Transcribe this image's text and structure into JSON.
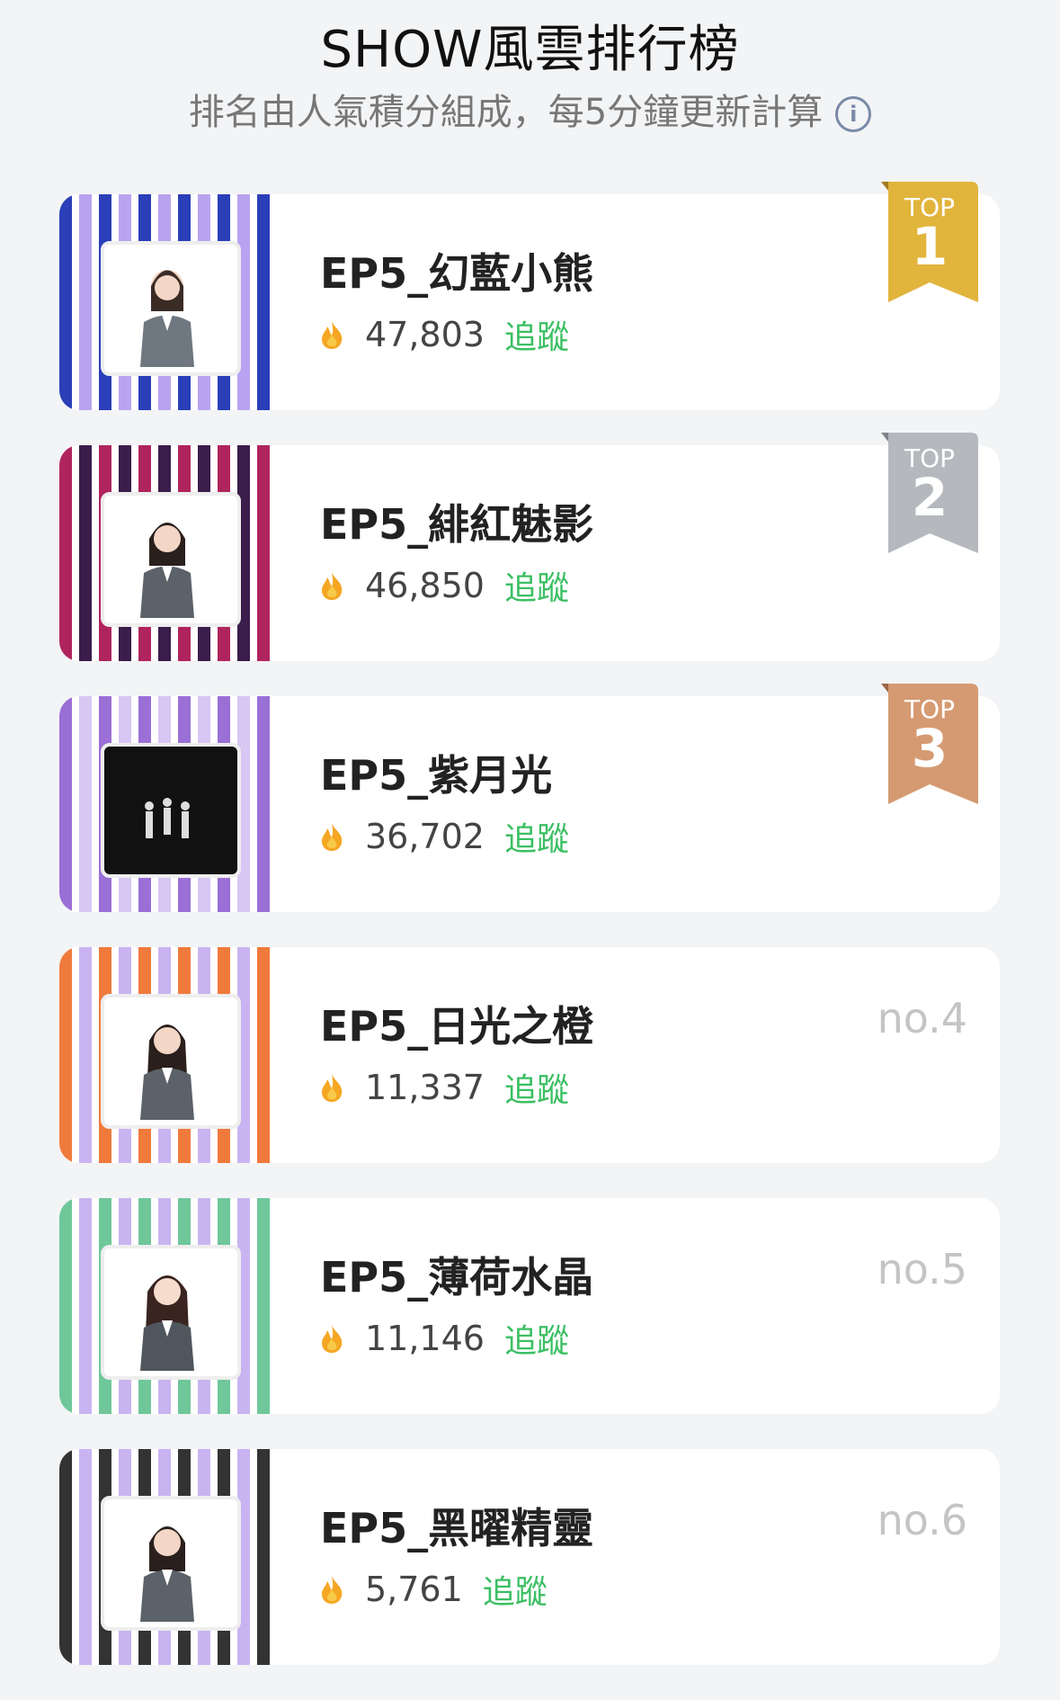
{
  "header": {
    "title": "SHOW風雲排行榜",
    "subtitle": "排名由人氣積分組成，每5分鐘更新計算"
  },
  "items": [
    {
      "name": "EP5_幻藍小熊",
      "score": "47,803",
      "follow": "追蹤",
      "badge_top": "TOP",
      "badge_num": "1",
      "badge_color": "#e1b43c",
      "theme_color": "#2a3fb8"
    },
    {
      "name": "EP5_緋紅魅影",
      "score": "46,850",
      "follow": "追蹤",
      "badge_top": "TOP",
      "badge_num": "2",
      "badge_color": "#b5b8bd",
      "theme_color": "#b0245e"
    },
    {
      "name": "EP5_紫月光",
      "score": "36,702",
      "follow": "追蹤",
      "badge_top": "TOP",
      "badge_num": "3",
      "badge_color": "#d69a72",
      "theme_color": "#9a6fd6"
    },
    {
      "name": "EP5_日光之橙",
      "score": "11,337",
      "follow": "追蹤",
      "rank": "no.4",
      "theme_color": "#f07a3c"
    },
    {
      "name": "EP5_薄荷水晶",
      "score": "11,146",
      "follow": "追蹤",
      "rank": "no.5",
      "theme_color": "#6fc79a"
    },
    {
      "name": "EP5_黑曜精靈",
      "score": "5,761",
      "follow": "追蹤",
      "rank": "no.6",
      "theme_color": "#333333"
    }
  ]
}
